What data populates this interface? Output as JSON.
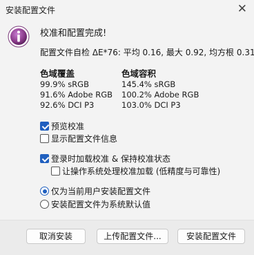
{
  "window": {
    "title": "安装配置文件",
    "close_glyph": "✕"
  },
  "message": {
    "heading": "校准和配置完成!",
    "delta_line": "配置文件自检 ΔE*76: 平均 0.16, 最大 0.92, 均方根 0.31"
  },
  "coverage": {
    "title": "色域覆盖",
    "rows": [
      "99.9% sRGB",
      "91.6% Adobe RGB",
      "92.6% DCI P3"
    ]
  },
  "volume": {
    "title": "色域容积",
    "rows": [
      "145.4% sRGB",
      "100.2% Adobe RGB",
      "103.0% DCI P3"
    ]
  },
  "options": {
    "preview_calibration": {
      "label": "预览校准",
      "checked": true
    },
    "show_profile_info": {
      "label": "显示配置文件信息",
      "checked": false
    },
    "load_on_login": {
      "label": "登录时加载校准 & 保持校准状态",
      "checked": true
    },
    "os_handles": {
      "label": "让操作系统处理校准加载 (低精度与可靠性)",
      "checked": false
    },
    "scope_current_user": {
      "label": "仅为当前用户安装配置文件",
      "selected": true
    },
    "scope_system_default": {
      "label": "安装配置文件为系统默认值",
      "selected": false
    }
  },
  "buttons": {
    "cancel": "取消安装",
    "upload": "上传配置文件...",
    "install": "安装配置文件"
  },
  "colors": {
    "accent": "#1f5fbf",
    "info_icon": "#8a3a8a"
  }
}
